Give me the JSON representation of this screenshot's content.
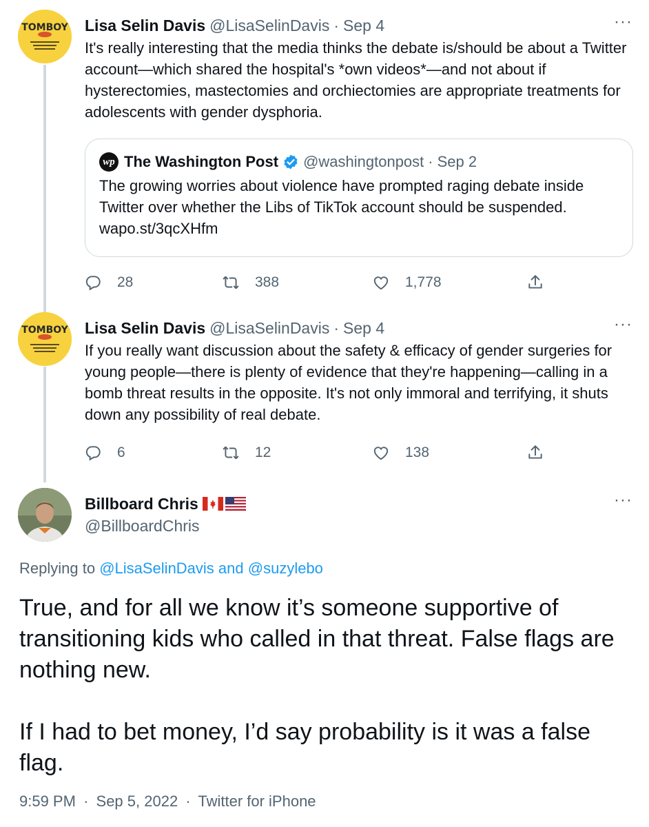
{
  "tweet1": {
    "author_name": "Lisa Selin Davis",
    "handle": "@LisaSelinDavis",
    "separator": "·",
    "date": "Sep 4",
    "more": "···",
    "avatar_text": "TOMBOY",
    "text": "It's really interesting that the media thinks the debate is/should be about a Twitter account—which shared the hospital's *own videos*—and not about if hysterectomies, mastectomies and orchiectomies are appropriate treatments for adolescents with gender dysphoria.",
    "quote": {
      "logo": "wp",
      "author_name": "The Washington Post",
      "handle": "@washingtonpost",
      "separator": "·",
      "date": "Sep 2",
      "text": "The growing worries about violence have prompted raging debate inside Twitter over whether the Libs of TikTok account should be suspended. wapo.st/3qcXHfm"
    },
    "replies": "28",
    "retweets": "388",
    "likes": "1,778"
  },
  "tweet2": {
    "author_name": "Lisa Selin Davis",
    "handle": "@LisaSelinDavis",
    "separator": "·",
    "date": "Sep 4",
    "more": "···",
    "avatar_text": "TOMBOY",
    "text": "If you really want discussion about the safety & efficacy of gender surgeries for young people—there is plenty of evidence that they're happening—calling in a bomb threat results in the opposite. It's not only immoral and terrifying, it shuts down any possibility of real debate.",
    "replies": "6",
    "retweets": "12",
    "likes": "138"
  },
  "main_tweet": {
    "author_name": "Billboard Chris",
    "handle": "@BillboardChris",
    "more": "···",
    "replying_prefix": "Replying to ",
    "replying_user1": "@LisaSelinDavis",
    "replying_and": " and ",
    "replying_user2": "@suzylebo",
    "paragraph1": "True, and for all we know it’s someone supportive of transitioning kids who called in that threat. False flags are nothing new.",
    "paragraph2": "If I had to bet money, I’d say probability is it was a false flag.",
    "time": "9:59 PM",
    "date": "Sep 5, 2022",
    "source": "Twitter for iPhone",
    "separator": "·"
  },
  "colors": {
    "text": "#0f1419",
    "secondary": "#536471",
    "link": "#1d9bf0",
    "border": "#cfd9de",
    "tomboy_yellow": "#f7d23e"
  },
  "icons": [
    "reply-icon",
    "retweet-icon",
    "like-icon",
    "share-icon",
    "more-icon",
    "verified-icon",
    "canada-flag-icon",
    "usa-flag-icon"
  ]
}
